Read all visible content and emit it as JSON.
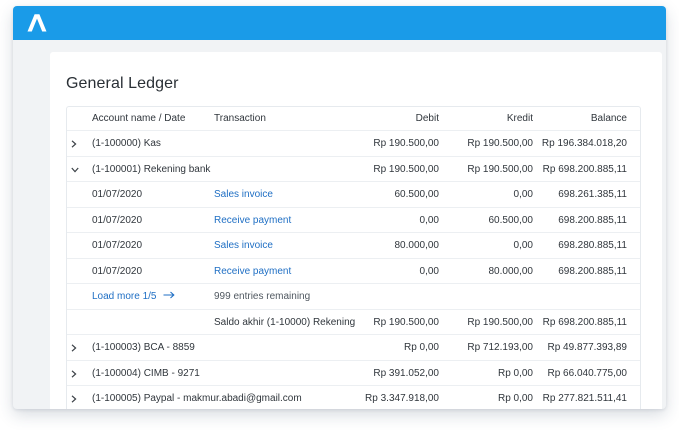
{
  "page_title": "General Ledger",
  "columns": {
    "account": "Account name / Date",
    "transaction": "Transaction",
    "debit": "Debit",
    "kredit": "Kredit",
    "balance": "Balance"
  },
  "accounts": [
    {
      "name": "(1-100000) Kas",
      "debit": "Rp 190.500,00",
      "kredit": "Rp 190.500,00",
      "balance": "Rp 196.384.018,20",
      "expanded": false
    },
    {
      "name": "(1-100001) Rekening bank",
      "debit": "Rp 190.500,00",
      "kredit": "Rp 190.500,00",
      "balance": "Rp 698.200.885,11",
      "expanded": true
    },
    {
      "name": "(1-100003) BCA - 8859",
      "debit": "Rp 0,00",
      "kredit": "Rp 712.193,00",
      "balance": "Rp 49.877.393,89",
      "expanded": false
    },
    {
      "name": "(1-100004) CIMB - 9271",
      "debit": "Rp 391.052,00",
      "kredit": "Rp 0,00",
      "balance": "Rp 66.040.775,00",
      "expanded": false
    },
    {
      "name": "(1-100005) Paypal - makmur.abadi@gmail.com",
      "debit": "Rp 3.347.918,00",
      "kredit": "Rp 0,00",
      "balance": "Rp 277.821.511,41",
      "expanded": false
    }
  ],
  "entries": [
    {
      "date": "01/07/2020",
      "transaction": "Sales invoice",
      "debit": "60.500,00",
      "kredit": "0,00",
      "balance": "698.261.385,11"
    },
    {
      "date": "01/07/2020",
      "transaction": "Receive payment",
      "debit": "0,00",
      "kredit": "60.500,00",
      "balance": "698.200.885,11"
    },
    {
      "date": "01/07/2020",
      "transaction": "Sales invoice",
      "debit": "80.000,00",
      "kredit": "0,00",
      "balance": "698.280.885,11"
    },
    {
      "date": "01/07/2020",
      "transaction": "Receive payment",
      "debit": "0,00",
      "kredit": "80.000,00",
      "balance": "698.200.885,11"
    }
  ],
  "load_more": {
    "label": "Load more 1/5",
    "remaining": "999 entries remaining",
    "icon": "arrow-right-icon"
  },
  "closing": {
    "label": "Saldo akhir (1-10000) Rekening",
    "debit": "Rp 190.500,00",
    "kredit": "Rp 190.500,00",
    "balance": "Rp 698.200.885,11"
  },
  "colors": {
    "topbar": "#1a9be8",
    "link": "#1f6fc4",
    "background": "#f1f3f5"
  }
}
